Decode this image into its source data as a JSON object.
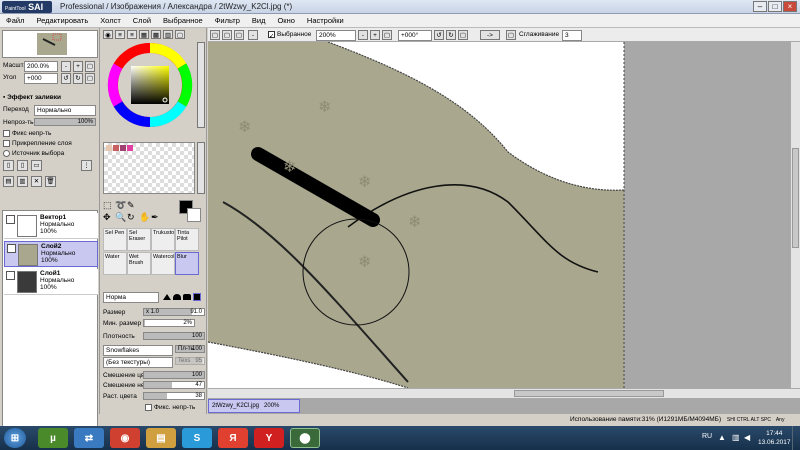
{
  "window": {
    "title": "Professional / Изображения / Александра / 2tWzwy_K2Cl.jpg (*)",
    "logo": "SAI",
    "logo_small": "PaintTool"
  },
  "menu": [
    "Файл",
    "Редактировать",
    "Холст",
    "Слой",
    "Выбранное",
    "Фильтр",
    "Вид",
    "Окно",
    "Настройки"
  ],
  "navigator": {
    "zoom_label": "Масштаб",
    "zoom_value": "200.0%",
    "angle_label": "Угол",
    "angle_value": "+000"
  },
  "effects": {
    "title": "Эффект заливки",
    "transition_label": "Переход",
    "transition_value": "Нормально",
    "opacity_label": "Непроз-ть",
    "opacity_value": "100%",
    "fix_opacity": "Фикс непр-ть",
    "clip_layer": "Прикрепление слоя",
    "source_select": "Источник выбора"
  },
  "layers": [
    {
      "name": "Вектор1",
      "mode": "Нормально",
      "opacity": "100%"
    },
    {
      "name": "Слой2",
      "mode": "Нормально",
      "opacity": "100%",
      "selected": true
    },
    {
      "name": "Слой1",
      "mode": "Нормально",
      "opacity": "100%"
    }
  ],
  "tools": [
    {
      "label": "Sel Pen"
    },
    {
      "label": "Sel Eraser"
    },
    {
      "label": "Trukusto"
    },
    {
      "label": "Tinta Pilot"
    },
    {
      "label": "Water"
    },
    {
      "label": "Wet Brush"
    },
    {
      "label": "Watercol"
    },
    {
      "label": "Blur",
      "selected": true
    }
  ],
  "brush": {
    "mode": "Норма",
    "size_label": "Размер",
    "size_mult": "x 1.0",
    "size_value": "91.0",
    "min_size_label": "Мин. размер",
    "min_size_value": "2%",
    "density_label": "Плотность",
    "density_value": "100",
    "shape": "Snowflakes",
    "shape_btn": "Пл-ть",
    "shape_value": "100",
    "texture": "(Без текстуры)",
    "texture_btn": "Texs",
    "texture_value": "95",
    "blend_label": "Смешение цв.",
    "blend_value": "100",
    "blend_opacity_label": "Смешение непр.",
    "blend_opacity_value": "47",
    "stretch_label": "Раст. цвета",
    "stretch_value": "38",
    "fix_opacity": "Фикс. непр-ть"
  },
  "canvas_toolbar": {
    "selection_label": "Выбранное",
    "zoom": "200%",
    "angle": "+000°",
    "arrow": "->",
    "smoothing_label": "Сглаживание",
    "smoothing_value": "3"
  },
  "doc_tab": {
    "name": "2tWzwy_K2Cl.jpg",
    "zoom": "200%"
  },
  "status": {
    "memory": "Использование памяти:31% (И1291МБ/М4094МБ)",
    "keys": "SHI CTRL ALT SPC",
    "tail": "Any"
  },
  "taskbar": {
    "lang": "RU",
    "time": "17:44",
    "date": "13.06.2017"
  },
  "colors": {
    "canvas_bg": "#a9a88e",
    "selected": "#c8c8f0"
  }
}
